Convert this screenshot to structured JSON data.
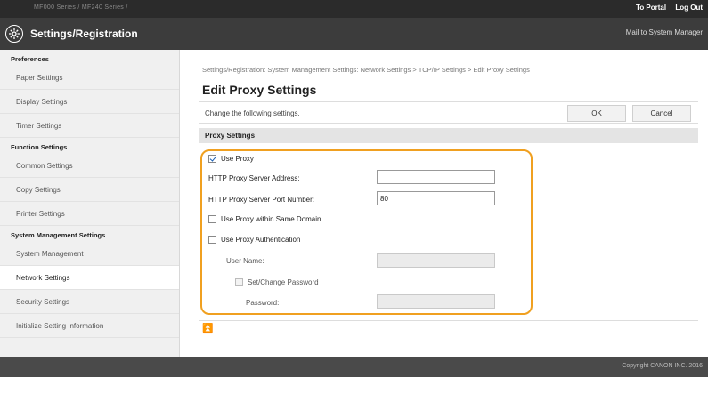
{
  "topbar": {
    "model": "MF000 Series / MF240 Series /",
    "portal": "To Portal",
    "logout": "Log Out"
  },
  "header": {
    "title": "Settings/Registration",
    "mail": "Mail to System Manager"
  },
  "sidebar": {
    "groups": [
      {
        "label": "Preferences",
        "items": [
          "Paper Settings",
          "Display Settings",
          "Timer Settings"
        ]
      },
      {
        "label": "Function Settings",
        "items": [
          "Common Settings",
          "Copy Settings",
          "Printer Settings"
        ]
      },
      {
        "label": "System Management Settings",
        "items": [
          "System Management",
          "Network Settings",
          "Security Settings",
          "Initialize Setting Information"
        ]
      }
    ],
    "active": "Network Settings"
  },
  "main": {
    "breadcrumb": "Settings/Registration: System Management Settings: Network Settings > TCP/IP Settings > Edit Proxy Settings",
    "title": "Edit Proxy Settings",
    "instruction": "Change the following settings.",
    "ok_label": "OK",
    "cancel_label": "Cancel",
    "section_title": "Proxy Settings",
    "use_proxy": {
      "label": "Use Proxy",
      "checked": true
    },
    "server_address": {
      "label": "HTTP Proxy Server Address:",
      "value": ""
    },
    "port_number": {
      "label": "HTTP Proxy Server Port Number:",
      "value": "80"
    },
    "same_domain": {
      "label": "Use Proxy within Same Domain",
      "checked": false
    },
    "authentication": {
      "label": "Use Proxy Authentication",
      "checked": false
    },
    "user_name": {
      "label": "User Name:",
      "value": ""
    },
    "set_password": {
      "label": "Set/Change Password",
      "checked": false
    },
    "password": {
      "label": "Password:",
      "value": ""
    },
    "to_top": "⏫"
  },
  "footer": {
    "copyright": "Copyright CANON INC. 2016"
  },
  "colors": {
    "highlight": "#f0a020",
    "topbar": "#2b2b2b",
    "header": "#3c3c3c"
  },
  "icons": {
    "header": "settings-gear-icon",
    "to_top": "to-top-arrow-icon"
  }
}
